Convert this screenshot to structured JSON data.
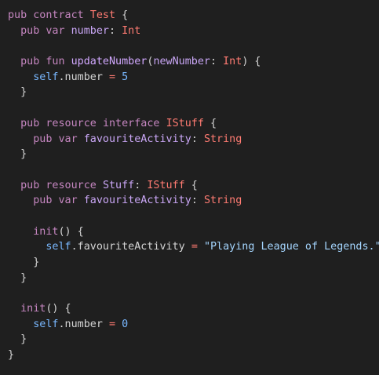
{
  "code": {
    "lines": [
      [
        {
          "t": "pub",
          "c": "kw"
        },
        {
          "t": " ",
          "c": "plain"
        },
        {
          "t": "contract",
          "c": "kw"
        },
        {
          "t": " ",
          "c": "plain"
        },
        {
          "t": "Test",
          "c": "type"
        },
        {
          "t": " {",
          "c": "punc"
        }
      ],
      [
        {
          "t": "  ",
          "c": "plain"
        },
        {
          "t": "pub",
          "c": "kw"
        },
        {
          "t": " ",
          "c": "plain"
        },
        {
          "t": "var",
          "c": "kw"
        },
        {
          "t": " ",
          "c": "plain"
        },
        {
          "t": "number",
          "c": "prop"
        },
        {
          "t": ": ",
          "c": "punc"
        },
        {
          "t": "Int",
          "c": "type"
        }
      ],
      [],
      [
        {
          "t": "  ",
          "c": "plain"
        },
        {
          "t": "pub",
          "c": "kw"
        },
        {
          "t": " ",
          "c": "plain"
        },
        {
          "t": "fun",
          "c": "kw"
        },
        {
          "t": " ",
          "c": "plain"
        },
        {
          "t": "updateNumber",
          "c": "fn"
        },
        {
          "t": "(",
          "c": "punc"
        },
        {
          "t": "newNumber",
          "c": "prop"
        },
        {
          "t": ": ",
          "c": "punc"
        },
        {
          "t": "Int",
          "c": "type"
        },
        {
          "t": ") {",
          "c": "punc"
        }
      ],
      [
        {
          "t": "    ",
          "c": "plain"
        },
        {
          "t": "self",
          "c": "self"
        },
        {
          "t": ".number ",
          "c": "plain"
        },
        {
          "t": "=",
          "c": "op"
        },
        {
          "t": " ",
          "c": "plain"
        },
        {
          "t": "5",
          "c": "num"
        }
      ],
      [
        {
          "t": "  }",
          "c": "punc"
        }
      ],
      [],
      [
        {
          "t": "  ",
          "c": "plain"
        },
        {
          "t": "pub",
          "c": "kw"
        },
        {
          "t": " ",
          "c": "plain"
        },
        {
          "t": "resource",
          "c": "kw"
        },
        {
          "t": " ",
          "c": "plain"
        },
        {
          "t": "interface",
          "c": "kw"
        },
        {
          "t": " ",
          "c": "plain"
        },
        {
          "t": "IStuff",
          "c": "type"
        },
        {
          "t": " {",
          "c": "punc"
        }
      ],
      [
        {
          "t": "    ",
          "c": "plain"
        },
        {
          "t": "pub",
          "c": "kw"
        },
        {
          "t": " ",
          "c": "plain"
        },
        {
          "t": "var",
          "c": "kw"
        },
        {
          "t": " ",
          "c": "plain"
        },
        {
          "t": "favouriteActivity",
          "c": "prop"
        },
        {
          "t": ": ",
          "c": "punc"
        },
        {
          "t": "String",
          "c": "type"
        }
      ],
      [
        {
          "t": "  }",
          "c": "punc"
        }
      ],
      [],
      [
        {
          "t": "  ",
          "c": "plain"
        },
        {
          "t": "pub",
          "c": "kw"
        },
        {
          "t": " ",
          "c": "plain"
        },
        {
          "t": "resource",
          "c": "kw"
        },
        {
          "t": " ",
          "c": "plain"
        },
        {
          "t": "Stuff",
          "c": "prop"
        },
        {
          "t": ": ",
          "c": "punc"
        },
        {
          "t": "IStuff",
          "c": "type"
        },
        {
          "t": " {",
          "c": "punc"
        }
      ],
      [
        {
          "t": "    ",
          "c": "plain"
        },
        {
          "t": "pub",
          "c": "kw"
        },
        {
          "t": " ",
          "c": "plain"
        },
        {
          "t": "var",
          "c": "kw"
        },
        {
          "t": " ",
          "c": "plain"
        },
        {
          "t": "favouriteActivity",
          "c": "prop"
        },
        {
          "t": ": ",
          "c": "punc"
        },
        {
          "t": "String",
          "c": "type"
        }
      ],
      [],
      [
        {
          "t": "    ",
          "c": "plain"
        },
        {
          "t": "init",
          "c": "kw"
        },
        {
          "t": "() {",
          "c": "punc"
        }
      ],
      [
        {
          "t": "      ",
          "c": "plain"
        },
        {
          "t": "self",
          "c": "self"
        },
        {
          "t": ".favouriteActivity ",
          "c": "plain"
        },
        {
          "t": "=",
          "c": "op"
        },
        {
          "t": " ",
          "c": "plain"
        },
        {
          "t": "\"Playing League of Legends.\"",
          "c": "str"
        }
      ],
      [
        {
          "t": "    }",
          "c": "punc"
        }
      ],
      [
        {
          "t": "  }",
          "c": "punc"
        }
      ],
      [],
      [
        {
          "t": "  ",
          "c": "plain"
        },
        {
          "t": "init",
          "c": "kw"
        },
        {
          "t": "() {",
          "c": "punc"
        }
      ],
      [
        {
          "t": "    ",
          "c": "plain"
        },
        {
          "t": "self",
          "c": "self"
        },
        {
          "t": ".number ",
          "c": "plain"
        },
        {
          "t": "=",
          "c": "op"
        },
        {
          "t": " ",
          "c": "plain"
        },
        {
          "t": "0",
          "c": "num"
        }
      ],
      [
        {
          "t": "  }",
          "c": "punc"
        }
      ],
      [
        {
          "t": "}",
          "c": "punc"
        }
      ]
    ]
  }
}
